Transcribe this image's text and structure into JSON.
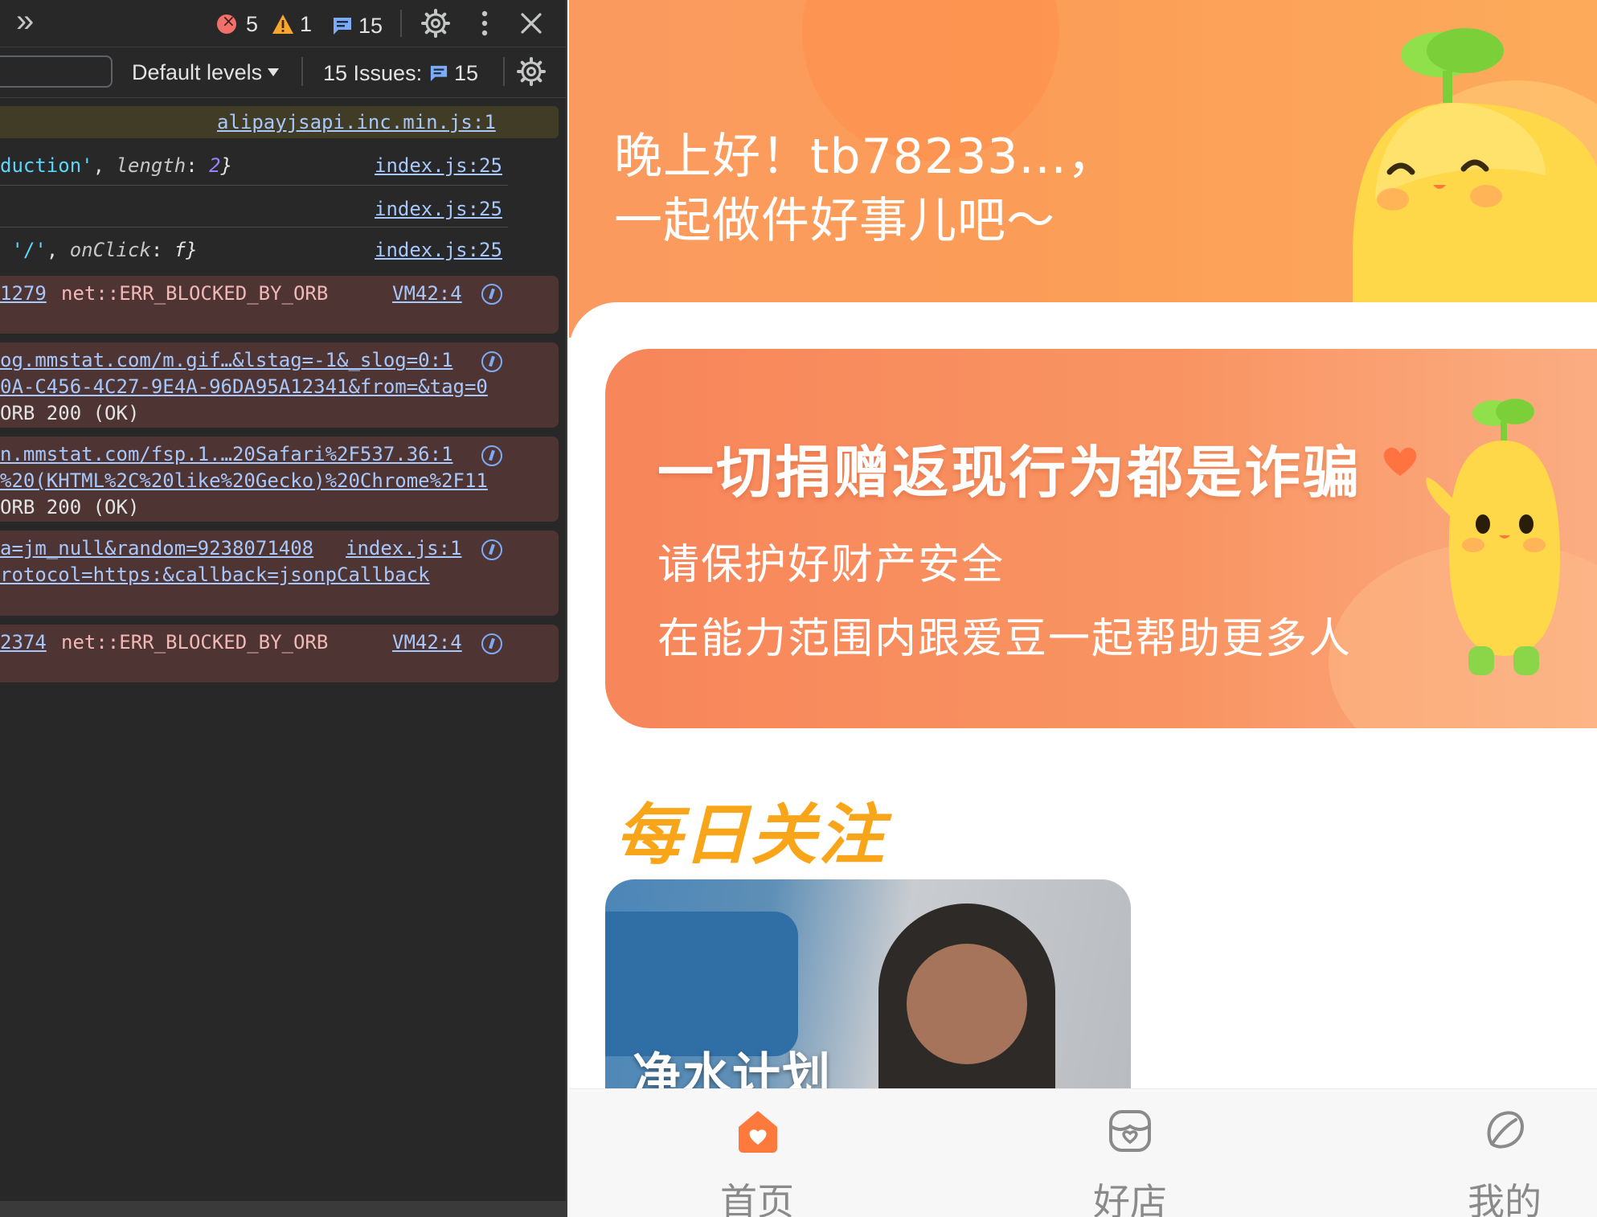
{
  "devtools": {
    "toolbar": {
      "more_tabs_glyph": "»",
      "errors": "5",
      "warnings": "1",
      "messages": "15"
    },
    "filter": {
      "levels_label": "Default levels",
      "issues_label": "15 Issues:",
      "issues_count": "15"
    },
    "rows": [
      {
        "source": "alipayjsapi.inc.min.js:1"
      },
      {
        "text_a": "duction'",
        "text_b": ", ",
        "text_c": "length",
        "text_d": ": ",
        "text_e": "2",
        "text_f": "}",
        "source": "index.js:25"
      },
      {
        "source": "index.js:25"
      },
      {
        "text_a": " '/'",
        "text_b": ", ",
        "text_c": "onClick",
        "text_d": ": ",
        "text_e": "f",
        "text_f": "}",
        "source": "index.js:25"
      },
      {
        "link": "1279",
        "message": "net::ERR_BLOCKED_BY_ORB",
        "source": "VM42:4"
      },
      {
        "line1": "og.mmstat.com/m.gif…&lstag=-1&_slog=0:1",
        "line2": "0A-C456-4C27-9E4A-96DA95A12341&from=&tag=0",
        "line3": "ORB 200 (OK)"
      },
      {
        "line1": "n.mmstat.com/fsp.1.…20Safari%2F537.36:1",
        "line2": "%20(KHTML%2C%20like%20Gecko)%20Chrome%2F11",
        "line3": "ORB 200 (OK)"
      },
      {
        "line1": "a=jm_null&random=9238071408",
        "source": "index.js:1",
        "line2": "rotocol=https:&callback=jsonpCallback"
      },
      {
        "link": "2374",
        "message": "net::ERR_BLOCKED_BY_ORB",
        "source": "VM42:4"
      }
    ]
  },
  "page": {
    "greeting_line1": "晚上好！tb78233...，",
    "greeting_line2": "一起做件好事儿吧～",
    "banner": {
      "title": "一切捐赠返现行为都是诈骗",
      "line1": "请保护好财产安全",
      "line2": "在能力范围内跟爱豆一起帮助更多人"
    },
    "daily_title": "每日关注",
    "card_label": "净水计划",
    "tabs": [
      {
        "label": "首页"
      },
      {
        "label": "好店"
      },
      {
        "label": "我的"
      }
    ]
  },
  "colors": {
    "devtools_bg": "#282828",
    "link": "#a8c7fa",
    "error_row": "#4e3534",
    "warn_row": "#413c26",
    "hero_orange": "#fb9a5f",
    "accent_orange": "#fe7a3c",
    "daily_yellow": "#f9a51a"
  }
}
